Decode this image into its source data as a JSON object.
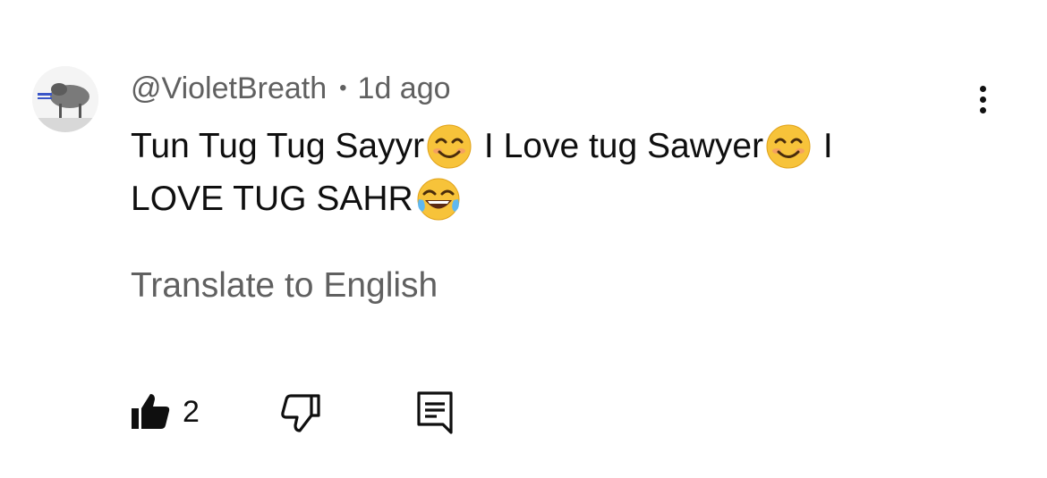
{
  "comment": {
    "author": "@VioletBreath",
    "separator": "•",
    "time": "1d ago",
    "text_segments": [
      "Tun Tug Tug Sayyr",
      " I Love tug Sawyer",
      " I LOVE TUG SAHR"
    ],
    "emojis": [
      "smiling-face-emoji",
      "smiling-face-emoji",
      "tears-of-joy-emoji"
    ],
    "translate_label": "Translate to English",
    "like_count": "2"
  },
  "icons": {
    "menu": "vertical-dots-icon",
    "like": "thumbs-up-filled-icon",
    "dislike": "thumbs-down-outline-icon",
    "reply": "reply-comment-icon"
  }
}
